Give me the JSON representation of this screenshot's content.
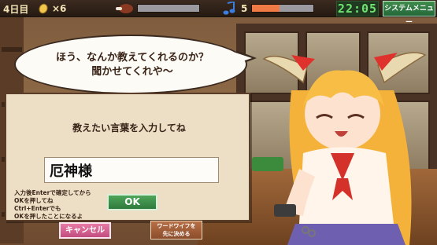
{
  "hud": {
    "day": "4日目",
    "coin_count": "×6",
    "note_count": "5",
    "clock": "22:05",
    "system_menu": "システムメニュー",
    "meat_bar_fill": 0.0,
    "note_bar_fill": 0.45
  },
  "bubble": {
    "line1": "ほう、なんか教えてくれるのか？",
    "line2": "聞かせてくれや〜"
  },
  "dialog": {
    "title": "教えたい言葉を入力してね",
    "input_value": "厄神様",
    "hint_line1": "入力後Enterで確定してから",
    "hint_line2": "OKを押してね",
    "hint_line3": "Ctrl+Enterでも",
    "hint_line4": "OKを押したことになるよ",
    "ok_label": "OK"
  },
  "buttons": {
    "cancel": "キャンセル",
    "wordwife_line1": "ワードワイフを",
    "wordwife_line2": "先に決める"
  },
  "colors": {
    "ok": "#3f8f4b",
    "cancel": "#d2608f",
    "clock": "#6fe36f",
    "note_bar": "#f07a45"
  },
  "icons": [
    "coin-icon",
    "meat-icon",
    "music-note-icon"
  ]
}
